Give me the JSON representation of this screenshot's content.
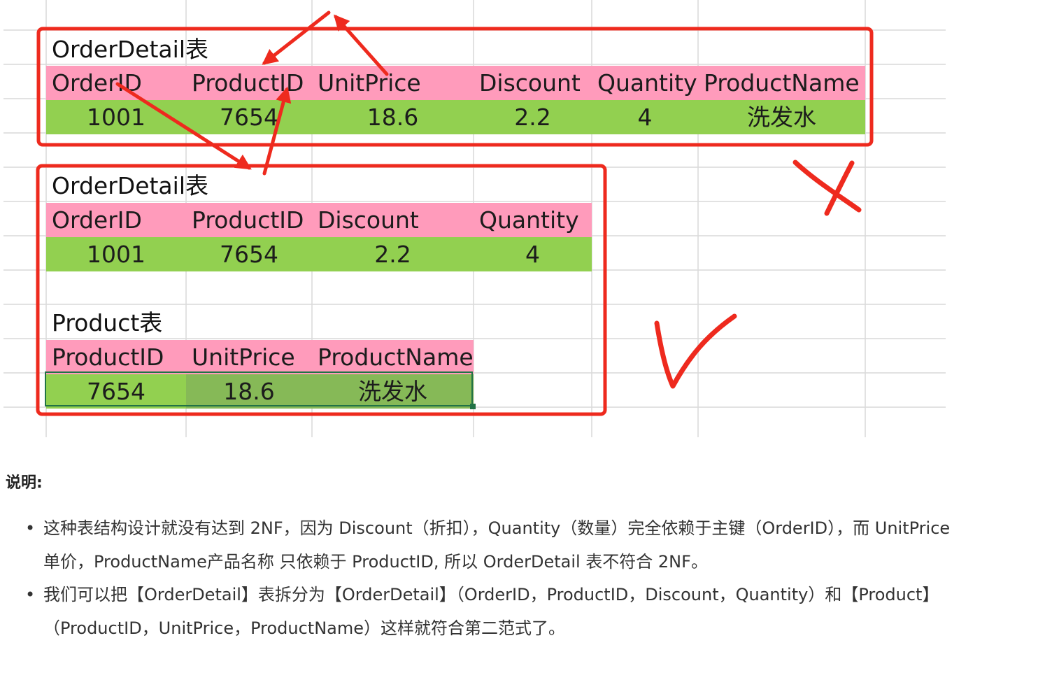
{
  "table1": {
    "title": "OrderDetail表",
    "headers": [
      "OrderID",
      "ProductID",
      "UnitPrice",
      "Discount",
      "Quantity",
      "ProductName"
    ],
    "row": [
      "1001",
      "7654",
      "18.6",
      "2.2",
      "4",
      "洗发水"
    ]
  },
  "table2": {
    "title": "OrderDetail表",
    "headers": [
      "OrderID",
      "ProductID",
      "Discount",
      "Quantity"
    ],
    "row": [
      "1001",
      "7654",
      "2.2",
      "4"
    ]
  },
  "table3": {
    "title": "Product表",
    "headers": [
      "ProductID",
      "UnitPrice",
      "ProductName"
    ],
    "row": [
      "7654",
      "18.6",
      "洗发水"
    ]
  },
  "colors": {
    "header_pink": "#ff9bbb",
    "data_green": "#92d050",
    "annotation_red": "#ee2a1e",
    "grid": "#d9d9d9"
  },
  "notes": {
    "heading": "说明:",
    "items": [
      "这种表结构设计就没有达到 2NF，因为 Discount（折扣），Quantity（数量）完全依赖于主键（OrderID），而 UnitPrice单价，ProductName产品名称 只依赖于 ProductID, 所以 OrderDetail 表不符合 2NF。",
      "我们可以把【OrderDetail】表拆分为【OrderDetail】（OrderID，ProductID，Discount，Quantity）和【Product】（ProductID，UnitPrice，ProductName）这样就符合第二范式了。"
    ]
  }
}
